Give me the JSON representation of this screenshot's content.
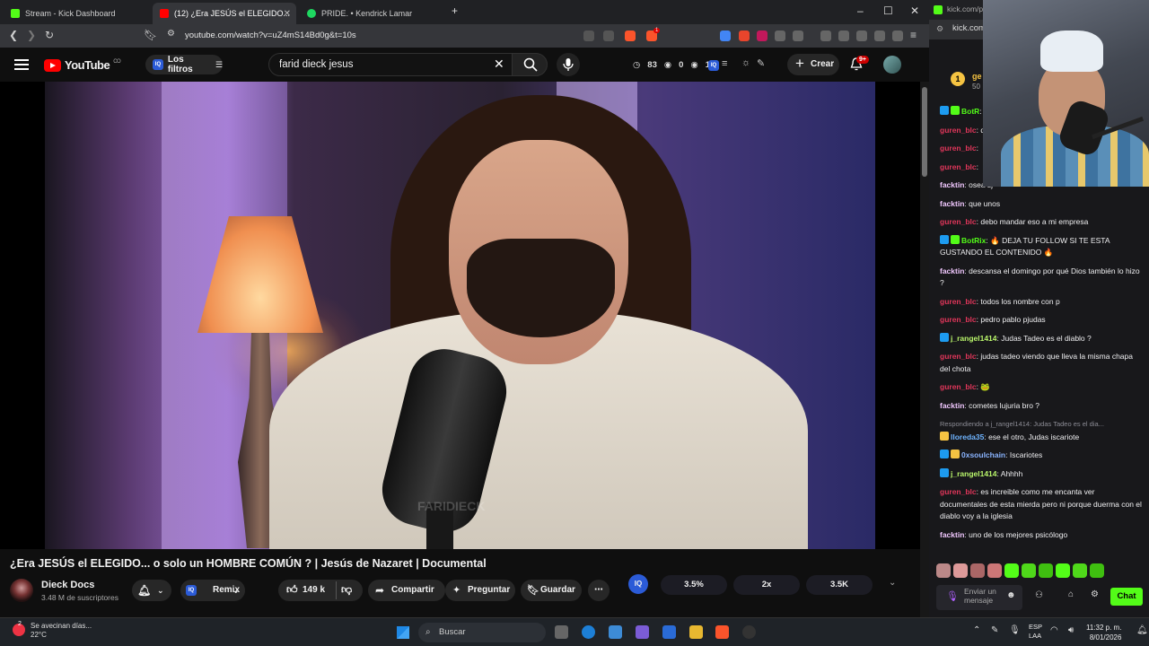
{
  "browser": {
    "tabs": [
      {
        "label": "Stream - Kick Dashboard",
        "favicon_color": "#53fc18"
      },
      {
        "label": "(12) ¿Era JESÚS el ELEGIDO...",
        "favicon_color": "#ff0000"
      },
      {
        "label": "PRIDE. • Kendrick Lamar",
        "favicon_color": "#1ed760"
      }
    ],
    "new_tab": "+",
    "url": "youtube.com/watch?v=uZ4mS14Bd0g&t=10s",
    "ext_badge": "1"
  },
  "youtube": {
    "logo_text": "YouTube",
    "logo_region": "CO",
    "filters_label": "Los filtros",
    "search_value": "farid dieck jesus",
    "stats": [
      "83",
      "0",
      "1"
    ],
    "create_label": "Crear",
    "notif_badge": "9+"
  },
  "video": {
    "watermark": "FARIDIECK",
    "title": "¿Era JESÚS el ELEGIDO... o solo un HOMBRE COMÚN ? | Jesús de Nazaret | Documental",
    "channel_name": "Dieck Docs",
    "subscribers": "3.48 M de suscriptores",
    "remix_label": "Remix",
    "likes": "149 k",
    "share_label": "Compartir",
    "ask_label": "Preguntar",
    "save_label": "Guardar",
    "iq_stats": [
      "3.5%",
      "2x",
      "3.5K"
    ]
  },
  "chat": {
    "url_partial": "kick.com/p",
    "tab_partial": "kick.com",
    "top_user_partial": "ge",
    "top_user_sub": "50",
    "messages": [
      {
        "user": "BotR",
        "color": "#53fc18",
        "text": "",
        "badges": [
          "#1d9bf0",
          "#53fc18"
        ]
      },
      {
        "user": "guren_blc",
        "color": "#e0365a",
        "text": "que hp fras",
        "badges": []
      },
      {
        "user": "guren_blc",
        "color": "#e0365a",
        "text": "",
        "badges": []
      },
      {
        "user": "guren_blc",
        "color": "#e0365a",
        "text": "",
        "badges": []
      },
      {
        "user": "facktin",
        "color": "#f1c8ff",
        "text": "osea sj",
        "badges": []
      },
      {
        "user": "facktin",
        "color": "#f1c8ff",
        "text": "que unos",
        "badges": []
      },
      {
        "user": "guren_blc",
        "color": "#e0365a",
        "text": "debo mandar eso a mi empresa",
        "badges": []
      },
      {
        "user": "BotRix",
        "color": "#53fc18",
        "text": "🔥 DEJA TU FOLLOW SI TE ESTA GUSTANDO EL CONTENIDO 🔥",
        "badges": [
          "#1d9bf0",
          "#53fc18"
        ]
      },
      {
        "user": "facktin",
        "color": "#f1c8ff",
        "text": "descansa el domingo por qué Dios también lo hizo ?",
        "badges": []
      },
      {
        "user": "guren_blc",
        "color": "#e0365a",
        "text": "todos los nombre con p",
        "badges": []
      },
      {
        "user": "guren_blc",
        "color": "#e0365a",
        "text": "pedro pablo pjudas",
        "badges": []
      },
      {
        "user": "j_rangel1414",
        "color": "#b9f56b",
        "text": "Judas Tadeo es el diablo ?",
        "badges": [
          "#1d9bf0"
        ]
      },
      {
        "user": "guren_blc",
        "color": "#e0365a",
        "text": "judas tadeo viendo que lleva la misma chapa del chota",
        "badges": []
      },
      {
        "user": "guren_blc",
        "color": "#e0365a",
        "text": "🐸",
        "badges": []
      },
      {
        "user": "facktin",
        "color": "#f1c8ff",
        "text": "cometes lujuria bro ?",
        "badges": []
      },
      {
        "reply": "Respondiendo a j_rangel1414: Judas Tadeo es el dia..."
      },
      {
        "user": "lloreda35",
        "color": "#6fb4ff",
        "text": "ese el otro, Judas iscariote",
        "badges": [
          "#f5c342"
        ]
      },
      {
        "user": "0xsoulchain",
        "color": "#8ab4ff",
        "text": "Iscariotes",
        "badges": [
          "#1d9bf0",
          "#f5c342"
        ]
      },
      {
        "user": "j_rangel1414",
        "color": "#b9f56b",
        "text": "Ahhhh",
        "badges": [
          "#1d9bf0"
        ]
      },
      {
        "user": "guren_blc",
        "color": "#e0365a",
        "text": "es increible como me encanta ver documentales de esta mierda pero ni porque duerma con el diablo voy a la iglesia",
        "badges": []
      },
      {
        "user": "facktin",
        "color": "#f1c8ff",
        "text": "uno de los mejores psicólogo",
        "badges": []
      }
    ],
    "input_placeholder": "Enviar un mensaje",
    "chat_button": "Chat"
  },
  "taskbar": {
    "weather_text": "Se avecinan días...",
    "weather_temp": "22°C",
    "search_placeholder": "Buscar",
    "lang_line1": "ESP",
    "lang_line2": "LAA",
    "time": "11:32 p. m.",
    "date": "8/01/2026",
    "notif_count": "2"
  }
}
